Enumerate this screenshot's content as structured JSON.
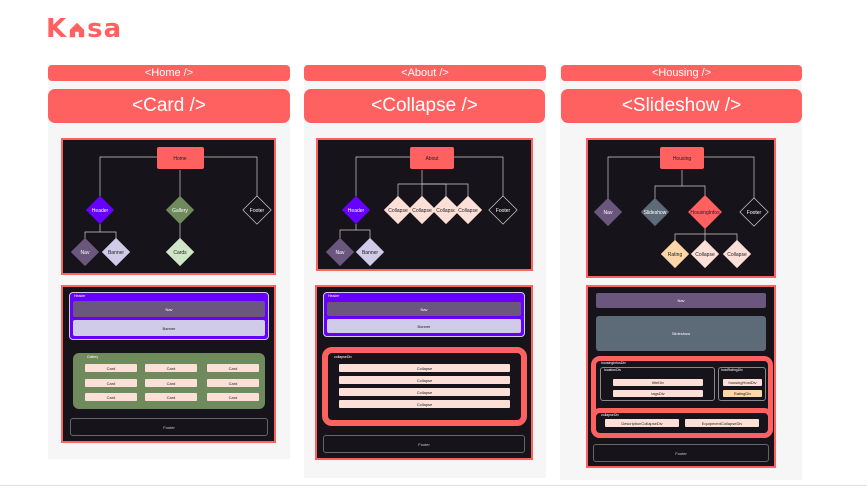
{
  "logo": {
    "prefix": "K",
    "suffix": "sa"
  },
  "columns": [
    {
      "route": "<Home />",
      "component": "<Card />",
      "tree": {
        "root": "Home",
        "children": [
          "Header",
          "Gallery",
          "Footer"
        ],
        "header_children": [
          "Nav",
          "Banner"
        ],
        "gallery_children": [
          "Cards"
        ]
      },
      "layout": {
        "header_tag": "Header",
        "nav": "Nav",
        "banner": "Banner",
        "gallery_tag": "Gallery",
        "cards": [
          "Card",
          "Card",
          "Card",
          "Card",
          "Card",
          "Card",
          "Card",
          "Card",
          "Card"
        ],
        "footer": "Footer"
      }
    },
    {
      "route": "<About />",
      "component": "<Collapse />",
      "tree": {
        "root": "About",
        "children": [
          "Header",
          "Collapse",
          "Collapse",
          "Collapse",
          "Collapse",
          "Footer"
        ],
        "header_children": [
          "Nav",
          "Banner"
        ]
      },
      "layout": {
        "header_tag": "Header",
        "nav": "Nav",
        "banner": "Banner",
        "collapse_tag": "collapseDiv",
        "collapses": [
          "Collapse",
          "Collapse",
          "Collapse",
          "Collapse"
        ],
        "footer": "Footer"
      }
    },
    {
      "route": "<Housing />",
      "component": "<Slideshow />",
      "tree": {
        "root": "Housing",
        "children": [
          "Nav",
          "Slideshow",
          "HousingInfos",
          "Footer"
        ],
        "info_children": [
          "Rating",
          "Collapse",
          "Collapse"
        ]
      },
      "layout": {
        "nav": "Nav",
        "slideshow": "Slideshow",
        "info_tag": "housingInfosDiv",
        "left_tag": "locationDiv",
        "title": "titleDiv",
        "tags": "tagsDiv",
        "right_tag": "hostRatingDiv",
        "host": "housingHostDiv",
        "rating": "RatingDiv",
        "collapse_tag": "collapseDiv",
        "desc": "DescriptionCollapseDiv",
        "equip": "EquipmentCollapseDiv",
        "footer": "Footer"
      }
    }
  ],
  "colors": {
    "accent": "#ff6060",
    "panel": "#16141a",
    "purple": "#6600ff",
    "gallery": "#6f8a5c",
    "nav": "#6b577e",
    "banner": "#d0cbe8",
    "card": "#fce0d8",
    "slideshow": "#5d6a77",
    "rating": "#ffd6a8"
  }
}
